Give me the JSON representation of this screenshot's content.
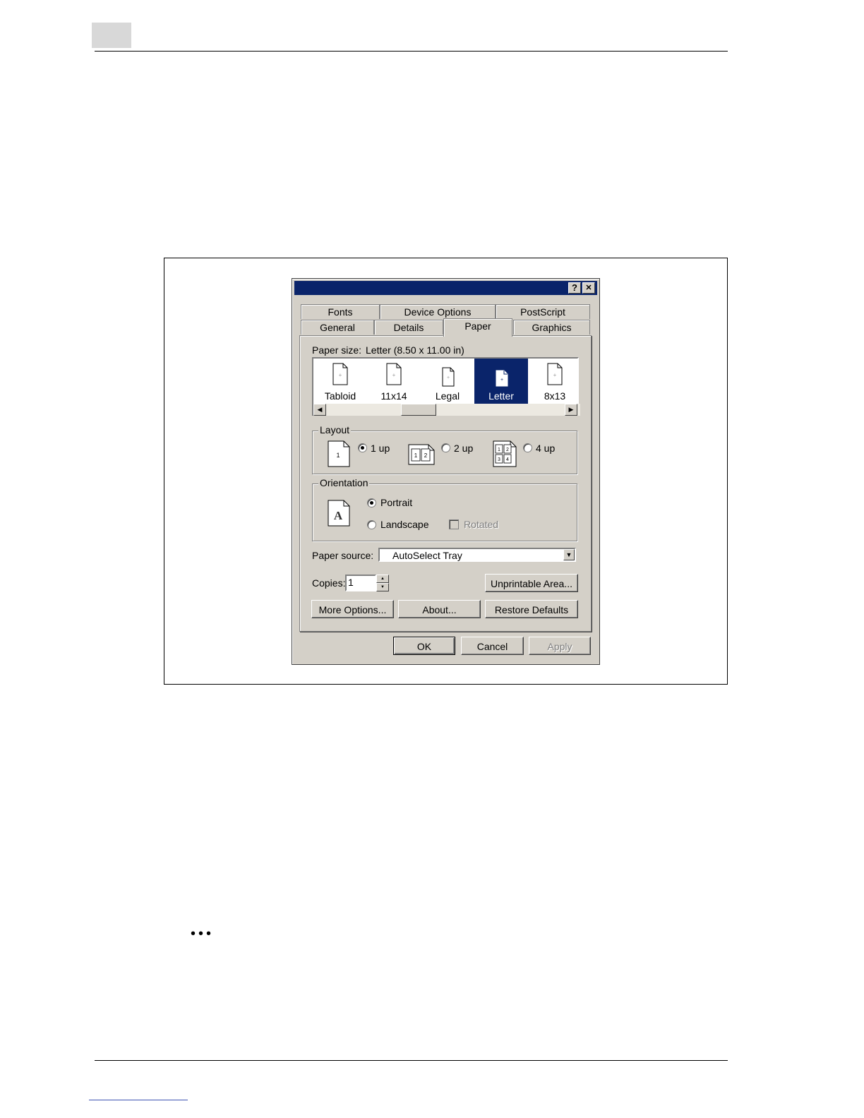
{
  "dialog": {
    "help_glyph": "?",
    "close_glyph": "✕",
    "tabs_row_back": [
      {
        "label": "Fonts"
      },
      {
        "label": "Device Options"
      },
      {
        "label": "PostScript"
      }
    ],
    "tabs_row_front": [
      {
        "label": "General"
      },
      {
        "label": "Details"
      },
      {
        "label": "Paper"
      },
      {
        "label": "Graphics"
      }
    ],
    "paper_size_label": "Paper size:",
    "paper_size_value": "Letter (8.50 x 11.00 in)",
    "paper_items": [
      {
        "name": "Tabloid"
      },
      {
        "name": "11x14"
      },
      {
        "name": "Legal"
      },
      {
        "name": "Letter"
      },
      {
        "name": "8x13"
      }
    ],
    "layout": {
      "title": "Layout",
      "icon_1up": "1",
      "icon_2up_a": "1",
      "icon_2up_b": "2",
      "icon_4up": [
        "1",
        "2",
        "3",
        "4"
      ],
      "opt_1up": "1 up",
      "opt_2up": "2 up",
      "opt_4up": "4 up"
    },
    "orientation": {
      "title": "Orientation",
      "icon_letter": "A",
      "portrait": "Portrait",
      "landscape": "Landscape",
      "rotated": "Rotated"
    },
    "paper_source_label": "Paper source:",
    "paper_source_value": "AutoSelect Tray",
    "copies_label": "Copies:",
    "copies_value": "1",
    "buttons": {
      "unprintable": "Unprintable Area...",
      "more_options": "More Options...",
      "about": "About...",
      "restore_defaults": "Restore Defaults",
      "ok": "OK",
      "cancel": "Cancel",
      "apply": "Apply"
    }
  },
  "colors": {
    "titlebar": "#0a246a",
    "face": "#d4d0c8",
    "selection": "#0a246a"
  }
}
